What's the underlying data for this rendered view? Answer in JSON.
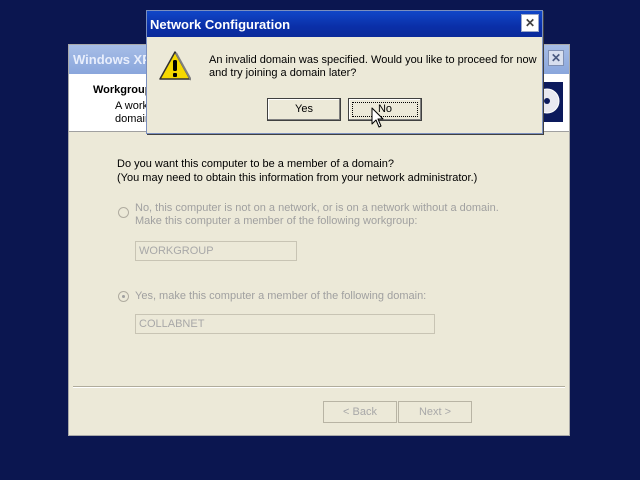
{
  "wizard": {
    "title": "Windows XP",
    "close_glyph": "✕",
    "header": {
      "title": "Workgroup",
      "subtitle": "A work domain"
    },
    "question_line1": "Do you want this computer to be a member of a domain?",
    "question_line2": "(You may need to obtain this information from your network administrator.)",
    "option_no": {
      "line1": "No, this computer is not on a network, or is on a network without a domain.",
      "line2": "Make this computer a member of the following workgroup:",
      "value": "WORKGROUP",
      "selected": false
    },
    "option_yes": {
      "line1": "Yes, make this computer a member of the following domain:",
      "value": "COLLABNET",
      "selected": true
    },
    "back_label": "< Back",
    "next_label": "Next >"
  },
  "dialog": {
    "title": "Network Configuration",
    "close_glyph": "✕",
    "icon": "warning-icon",
    "message": "An invalid domain was specified. Would you like to proceed for now and try joining a domain later?",
    "yes_label": "Yes",
    "no_label": "No"
  },
  "colors": {
    "desktop": "#0b1650",
    "dialog_titlebar": "#0a2fa8",
    "window_face": "#ece9d8",
    "warning": "#f5d800"
  }
}
